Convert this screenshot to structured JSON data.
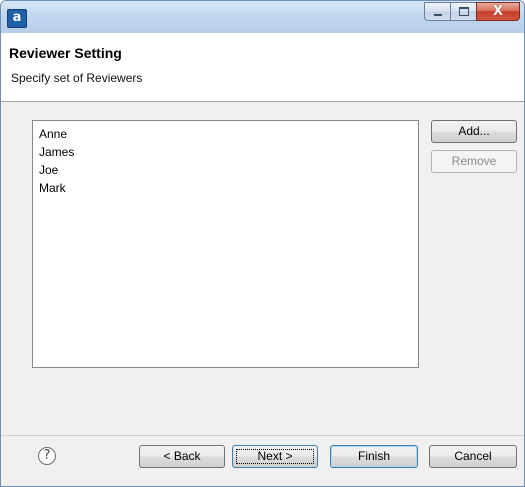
{
  "window": {
    "app_icon_letter": "a",
    "controls": {
      "minimize": "minimize",
      "maximize": "maximize",
      "close": "X"
    }
  },
  "header": {
    "title": "Reviewer Setting",
    "subtitle": "Specify set of Reviewers"
  },
  "reviewers": {
    "items": [
      "Anne",
      "James",
      "Joe",
      "Mark"
    ],
    "add_label": "Add...",
    "remove_label": "Remove"
  },
  "footer": {
    "help_glyph": "?",
    "back_label": "< Back",
    "next_label": "Next >",
    "finish_label": "Finish",
    "cancel_label": "Cancel"
  },
  "colors": {
    "title_bar": "#c2d7ef",
    "close_button": "#c4402a",
    "default_button_border": "#3c7fb1"
  }
}
